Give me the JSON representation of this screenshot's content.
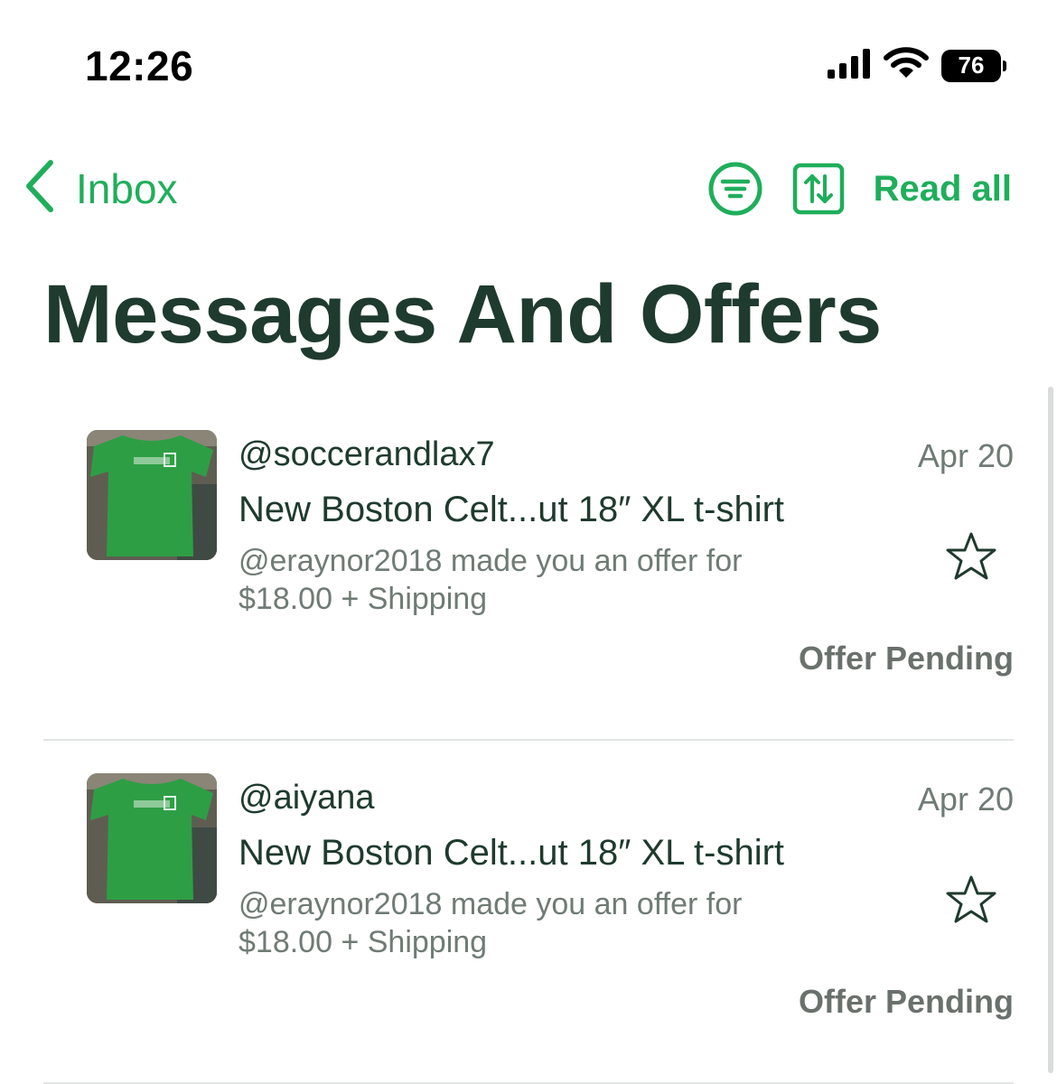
{
  "status_bar": {
    "time": "12:26",
    "battery": "76",
    "icons": [
      "cellular-signal-icon",
      "wifi-icon",
      "battery-icon"
    ]
  },
  "nav": {
    "back_label": "Inbox",
    "back_icon": "chevron-left-icon",
    "filter_icon": "filter-icon",
    "sort_icon": "sort-icon",
    "read_all_label": "Read all",
    "accent_color": "#1fae5b"
  },
  "page": {
    "title": "Messages And Offers"
  },
  "messages": [
    {
      "sender": "@soccerandlax7",
      "date": "Apr 20",
      "title": "New Boston Celt...ut 18″ XL t-shirt",
      "preview": "@eraynor2018 made you an offer for $18.00 + Shipping",
      "status": "Offer Pending",
      "starred": false
    },
    {
      "sender": "@aiyana",
      "date": "Apr 20",
      "title": "New Boston Celt...ut 18″ XL t-shirt",
      "preview": "@eraynor2018 made you an offer for $18.00 + Shipping",
      "status": "Offer Pending",
      "starred": false
    }
  ]
}
